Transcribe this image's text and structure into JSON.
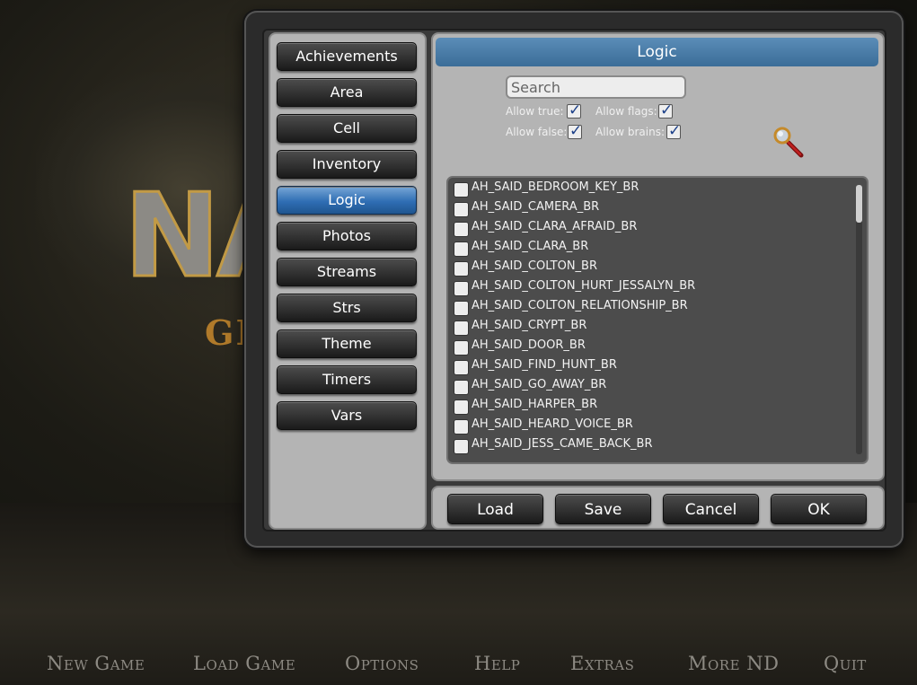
{
  "background": {
    "title": "NA",
    "subtitle": "GI"
  },
  "main_menu": [
    {
      "label": "New Game"
    },
    {
      "label": "Load Game"
    },
    {
      "label": "Options"
    },
    {
      "label": "Help"
    },
    {
      "label": "Extras"
    },
    {
      "label": "More ND"
    },
    {
      "label": "Quit"
    }
  ],
  "sidebar": {
    "items": [
      {
        "label": "Achievements"
      },
      {
        "label": "Area"
      },
      {
        "label": "Cell"
      },
      {
        "label": "Inventory"
      },
      {
        "label": "Logic",
        "active": true
      },
      {
        "label": "Photos"
      },
      {
        "label": "Streams"
      },
      {
        "label": "Strs"
      },
      {
        "label": "Theme"
      },
      {
        "label": "Timers"
      },
      {
        "label": "Vars"
      }
    ]
  },
  "panel": {
    "title": "Logic",
    "search": {
      "placeholder": "Search",
      "value": ""
    },
    "filters": {
      "allow_true": {
        "label": "Allow true:",
        "checked": true
      },
      "allow_flags": {
        "label": "Allow flags:",
        "checked": true
      },
      "allow_false": {
        "label": "Allow false:",
        "checked": true
      },
      "allow_brains": {
        "label": "Allow brains:",
        "checked": true
      }
    },
    "search_icon": "magnifier-icon",
    "flags": [
      {
        "name": "AH_SAID_BEDROOM_KEY_BR",
        "checked": false
      },
      {
        "name": "AH_SAID_CAMERA_BR",
        "checked": false
      },
      {
        "name": "AH_SAID_CLARA_AFRAID_BR",
        "checked": false
      },
      {
        "name": "AH_SAID_CLARA_BR",
        "checked": false
      },
      {
        "name": "AH_SAID_COLTON_BR",
        "checked": false
      },
      {
        "name": "AH_SAID_COLTON_HURT_JESSALYN_BR",
        "checked": false
      },
      {
        "name": "AH_SAID_COLTON_RELATIONSHIP_BR",
        "checked": false
      },
      {
        "name": "AH_SAID_CRYPT_BR",
        "checked": false
      },
      {
        "name": "AH_SAID_DOOR_BR",
        "checked": false
      },
      {
        "name": "AH_SAID_FIND_HUNT_BR",
        "checked": false
      },
      {
        "name": "AH_SAID_GO_AWAY_BR",
        "checked": false
      },
      {
        "name": "AH_SAID_HARPER_BR",
        "checked": false
      },
      {
        "name": "AH_SAID_HEARD_VOICE_BR",
        "checked": false
      },
      {
        "name": "AH_SAID_JESS_CAME_BACK_BR",
        "checked": false
      }
    ]
  },
  "footer": {
    "load_label": "Load",
    "save_label": "Save",
    "cancel_label": "Cancel",
    "ok_label": "OK"
  },
  "colors": {
    "accent_active": "#3a7cc4",
    "header_blue": "#4a7ca8",
    "panel_gray": "#b4b4b4"
  }
}
